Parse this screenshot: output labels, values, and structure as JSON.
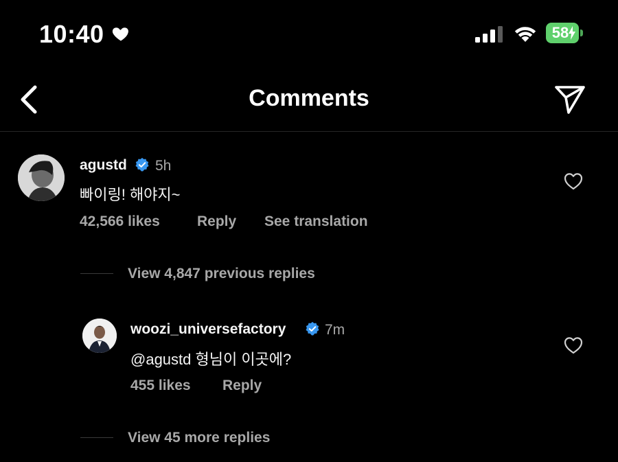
{
  "status_bar": {
    "time": "10:40",
    "battery": "58"
  },
  "header": {
    "title": "Comments"
  },
  "comments": [
    {
      "username": "agustd",
      "time": "5h",
      "text": "빠이링! 해야지~",
      "likes": "42,566 likes",
      "reply_label": "Reply",
      "translation_label": "See translation",
      "view_previous": "View 4,847 previous replies"
    }
  ],
  "replies": [
    {
      "username": "woozi_universefactory",
      "time": "7m",
      "text": "@agustd 형님이 이곳에?",
      "likes": "455 likes",
      "reply_label": "Reply",
      "view_more": "View 45 more replies"
    }
  ],
  "colors": {
    "background": "#000000",
    "text": "#f5f5f5",
    "secondary_text": "#a8a8a8",
    "verified": "#3897f0",
    "battery": "#5fd06c"
  }
}
